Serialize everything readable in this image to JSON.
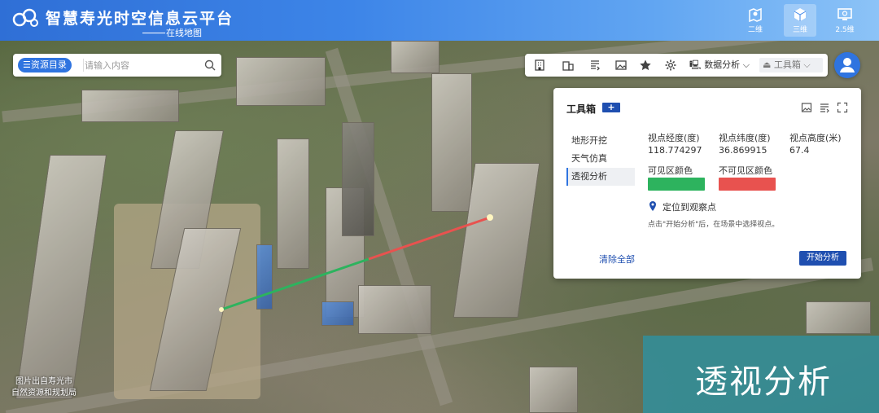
{
  "header": {
    "title": "智慧寿光时空信息云平台",
    "subtitle": "在线地图",
    "views": [
      {
        "label": "二维",
        "icon": "map-pin-icon"
      },
      {
        "label": "三维",
        "icon": "cube-icon",
        "active": true
      },
      {
        "label": "2.5维",
        "icon": "monitor-icon"
      }
    ]
  },
  "search": {
    "catalog_label": "资源目录",
    "placeholder": "请输入内容"
  },
  "toolbar": {
    "icons": [
      "building-icon",
      "office-icon",
      "layers-list-icon",
      "image-icon",
      "star-icon",
      "gear-icon"
    ],
    "data_analysis_label": "数据分析",
    "toolbox_label": "工具箱"
  },
  "panel": {
    "title": "工具箱",
    "add_label": "+",
    "menu": [
      "地形开挖",
      "天气仿真",
      "透视分析"
    ],
    "active_menu": "透视分析",
    "longitude_label": "视点经度(度)",
    "longitude_value": "118.774297",
    "latitude_label": "视点纬度(度)",
    "latitude_value": "36.869915",
    "height_label": "视点高度(米)",
    "height_value": "67.4",
    "visible_color_label": "可见区颜色",
    "visible_color": "#2db35e",
    "invisible_color_label": "不可见区颜色",
    "invisible_color": "#e8524f",
    "locate_label": "定位到观察点",
    "hint": "点击\"开始分析\"后，在场景中选择视点。",
    "clear_label": "清除全部",
    "start_label": "开始分析"
  },
  "credit": {
    "line1": "图片出自寿光市",
    "line2": "自然资源和规划局"
  },
  "banner": {
    "text": "透视分析"
  },
  "colors": {
    "header_blue": "#3d85e8",
    "accent": "#1f4fb0",
    "visible_line": "#2db35e",
    "invisible_line": "#e8524f"
  }
}
